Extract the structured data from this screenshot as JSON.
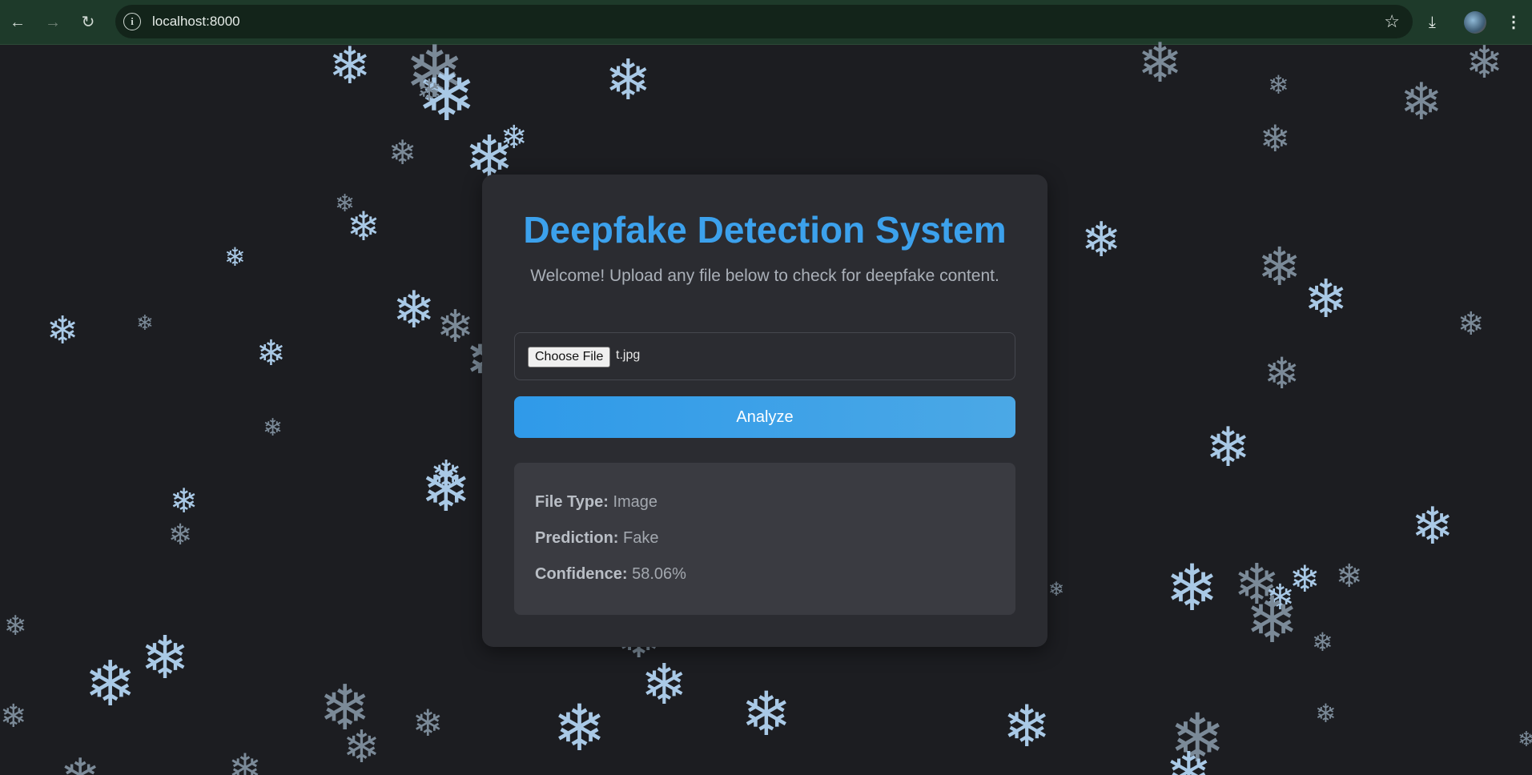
{
  "browser": {
    "url": "localhost:8000",
    "icons": [
      "back-arrow-icon",
      "forward-arrow-icon",
      "reload-icon",
      "site-info-icon",
      "bookmark-star-icon",
      "download-icon",
      "profile-avatar",
      "kebab-menu-icon"
    ]
  },
  "page": {
    "title": "Deepfake Detection System",
    "subtitle": "Welcome! Upload any file below to check for deepfake content.",
    "file_input": {
      "button_label": "Choose File",
      "selected_file": "t.jpg"
    },
    "analyze_label": "Analyze",
    "results": {
      "file_type_label": "File Type:",
      "file_type_value": "Image",
      "prediction_label": "Prediction:",
      "prediction_value": "Fake",
      "confidence_label": "Confidence:",
      "confidence_value": "58.06%"
    }
  },
  "colors": {
    "background": "#1c1d21",
    "card": "#2b2c31",
    "title": "#3ca1ec",
    "button": "#2f9ae9",
    "results_panel": "#3a3b41",
    "snowflake": "#a9c9e6"
  }
}
